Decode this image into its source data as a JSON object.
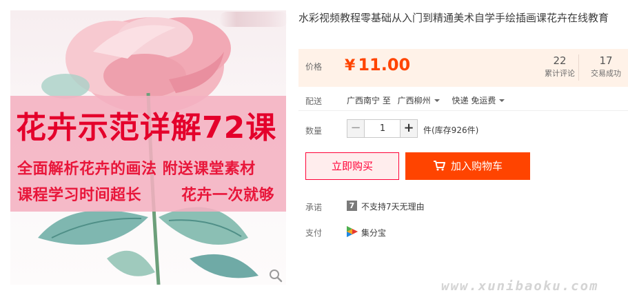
{
  "header": {
    "corner_mark": "”"
  },
  "product": {
    "title": "水彩视频教程零基础从入门到精通美术自学手绘插画课花卉在线教育"
  },
  "image": {
    "banner_title": "花卉示范详解72课",
    "banner_line1": "全面解析花卉的画法  附送课堂素材",
    "banner_line2_left": "课程学习时间超长",
    "banner_line2_right": "花卉一次就够",
    "zoom_icon": "magnifier-icon"
  },
  "price": {
    "label": "价格",
    "currency": "¥",
    "value": "11.00",
    "color": "#ff4400",
    "reviews_count": "22",
    "reviews_label": "累计评论",
    "deals_count": "17",
    "deals_label": "交易成功"
  },
  "shipping": {
    "label": "配送",
    "from": "广西南宁 至",
    "to": "广西柳州",
    "method": "快递 免运费"
  },
  "quantity": {
    "label": "数量",
    "minus": "−",
    "value": "1",
    "plus": "+",
    "stock": "件(库存926件)"
  },
  "actions": {
    "buy_now": "立即购买",
    "add_to_cart": "加入购物车",
    "buy_color": "#ff0036",
    "cart_color": "#ff4400"
  },
  "promise": {
    "label": "承诺",
    "icon_text": "7",
    "text": "不支持7天无理由"
  },
  "payment": {
    "label": "支付",
    "method": "集分宝"
  },
  "watermark": "www.xunibaoku.com"
}
